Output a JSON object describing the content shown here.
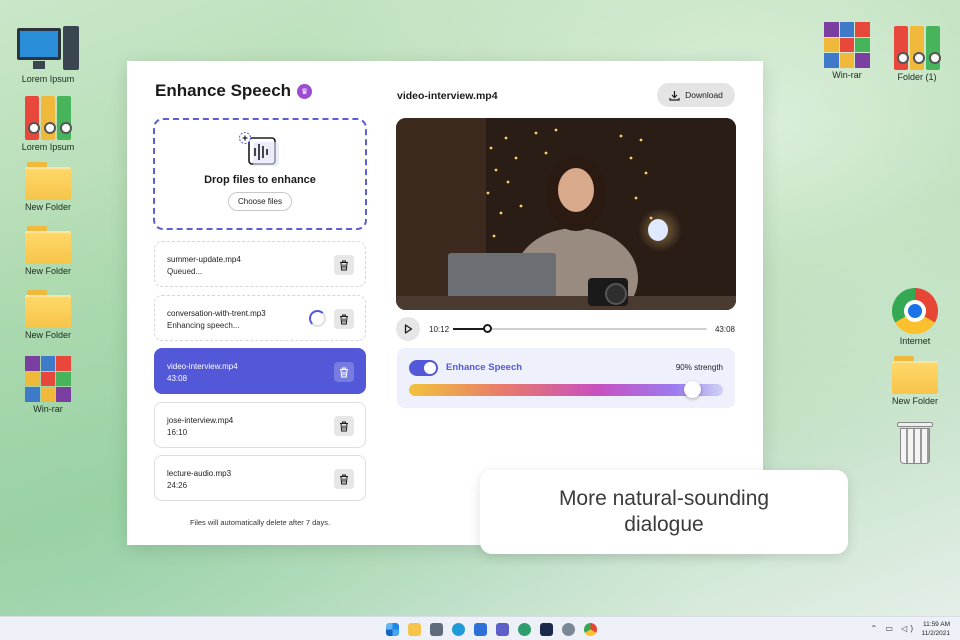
{
  "desktop": {
    "left_icons": [
      {
        "label": "Lorem Ipsum",
        "type": "pc"
      },
      {
        "label": "Lorem Ipsum",
        "type": "binder"
      },
      {
        "label": "New Folder",
        "type": "folder"
      },
      {
        "label": "New Folder",
        "type": "folder"
      },
      {
        "label": "New Folder",
        "type": "folder"
      },
      {
        "label": "Win-rar",
        "type": "winrar"
      }
    ],
    "right_icons": [
      {
        "label": "Win-rar",
        "type": "winrar"
      },
      {
        "label": "Folder (1)",
        "type": "binder"
      },
      {
        "label": "Internet",
        "type": "chrome"
      },
      {
        "label": "New Folder",
        "type": "folder"
      },
      {
        "label": "",
        "type": "trash"
      }
    ]
  },
  "app": {
    "title": "Enhance Speech",
    "dropzone": {
      "title": "Drop files to enhance",
      "button": "Choose files"
    },
    "files": [
      {
        "name": "summer-update.mp4",
        "sub": "Queued...",
        "state": "queued"
      },
      {
        "name": "conversation-with-trent.mp3",
        "sub": "Enhancing speech...",
        "state": "processing"
      },
      {
        "name": "video-interview.mp4",
        "sub": "43:08",
        "state": "active"
      },
      {
        "name": "jose-interview.mp4",
        "sub": "16:10",
        "state": "done"
      },
      {
        "name": "lecture-audio.mp3",
        "sub": "24:26",
        "state": "done"
      }
    ],
    "footnote": "Files will automatically delete after 7 days.",
    "video": {
      "title": "video-interview.mp4",
      "download_label": "Download",
      "current_time": "10:12",
      "total_time": "43:08",
      "progress": 0.135
    },
    "enhance": {
      "label": "Enhance Speech",
      "enabled": true,
      "strength_value": "90",
      "strength_label": "strength",
      "strength": 0.9
    }
  },
  "callout": {
    "text": "More natural-sounding dialogue"
  },
  "taskbar": {
    "time": "11:59 AM",
    "date": "11/2/2021"
  },
  "colors": {
    "accent": "#5358d8",
    "crown": "#9b4bd4"
  }
}
